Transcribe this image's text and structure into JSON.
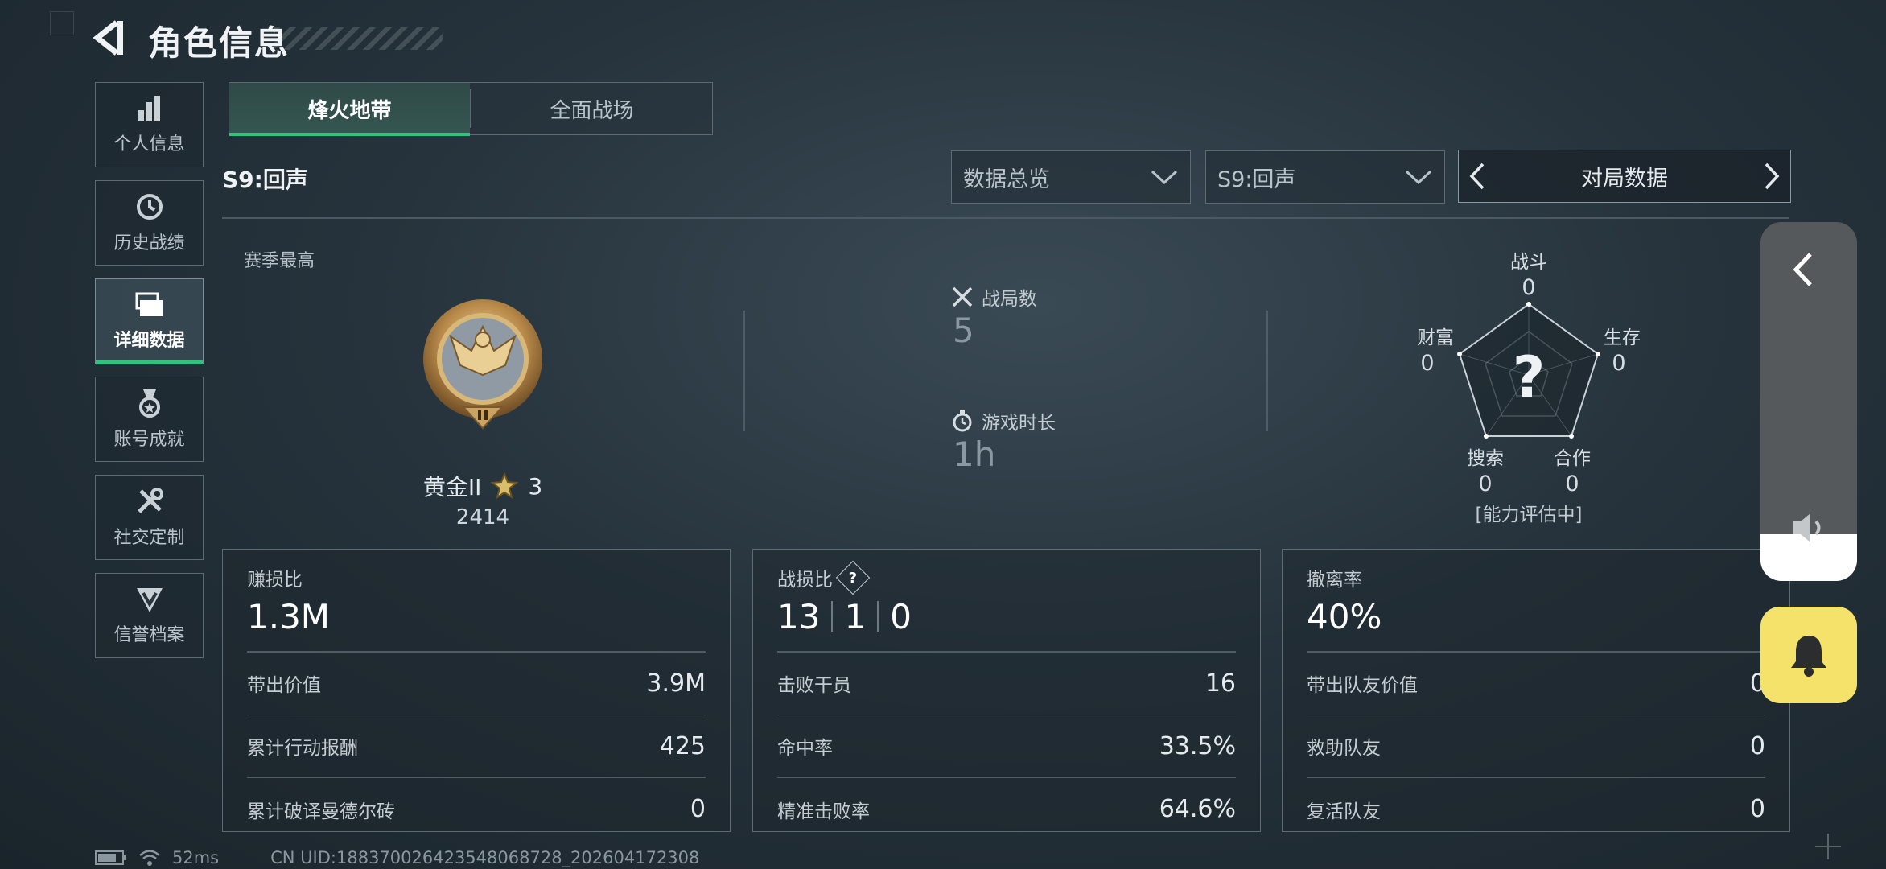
{
  "header": {
    "title": "角色信息"
  },
  "sidebar": {
    "items": [
      {
        "label": "个人信息",
        "icon": "bar-chart-icon"
      },
      {
        "label": "历史战绩",
        "icon": "history-clock-icon"
      },
      {
        "label": "详细数据",
        "icon": "cards-icon",
        "active": true
      },
      {
        "label": "账号成就",
        "icon": "medal-ribbon-icon"
      },
      {
        "label": "社交定制",
        "icon": "tools-icon"
      },
      {
        "label": "信誉档案",
        "icon": "shield-emblem-icon"
      }
    ]
  },
  "tabs": [
    {
      "label": "烽火地带",
      "active": true
    },
    {
      "label": "全面战场",
      "active": false
    }
  ],
  "season": {
    "title": "S9:回声"
  },
  "filters": {
    "dropdown1": "数据总览",
    "dropdown2": "S9:回声",
    "pager_label": "对局数据"
  },
  "season_best": {
    "label": "赛季最高",
    "rank": "黄金II",
    "stars": "3",
    "score": "2414"
  },
  "summary": {
    "matches_label": "战局数",
    "matches_value": "5",
    "playtime_label": "游戏时长",
    "playtime_value": "1h"
  },
  "radar": {
    "axes": [
      {
        "label": "战斗",
        "value": "0"
      },
      {
        "label": "生存",
        "value": "0"
      },
      {
        "label": "合作",
        "value": "0"
      },
      {
        "label": "搜索",
        "value": "0"
      },
      {
        "label": "财富",
        "value": "0"
      }
    ],
    "center_symbol": "?",
    "note": "[能力评估中]"
  },
  "panels": {
    "profit": {
      "label": "赚损比",
      "value": "1.3M",
      "rows": [
        {
          "label": "带出价值",
          "value": "3.9M"
        },
        {
          "label": "累计行动报酬",
          "value": "425"
        },
        {
          "label": "累计破译曼德尔砖",
          "value": "0"
        }
      ]
    },
    "combat": {
      "label": "战损比",
      "help": "?",
      "values": [
        "13",
        "1",
        "0"
      ],
      "rows": [
        {
          "label": "击败干员",
          "value": "16"
        },
        {
          "label": "命中率",
          "value": "33.5%"
        },
        {
          "label": "精准击败率",
          "value": "64.6%"
        }
      ]
    },
    "extract": {
      "label": "撤离率",
      "value": "40%",
      "rows": [
        {
          "label": "带出队友价值",
          "value": "0"
        },
        {
          "label": "救助队友",
          "value": "0"
        },
        {
          "label": "复活队友",
          "value": "0"
        }
      ]
    }
  },
  "volume": {
    "level": 0.13
  },
  "footer": {
    "ping": "52ms",
    "uid": "CN UID:1883700264235480687​28_202604172308"
  },
  "colors": {
    "accent": "#33c27e",
    "bell_bg": "#f5e26a"
  }
}
